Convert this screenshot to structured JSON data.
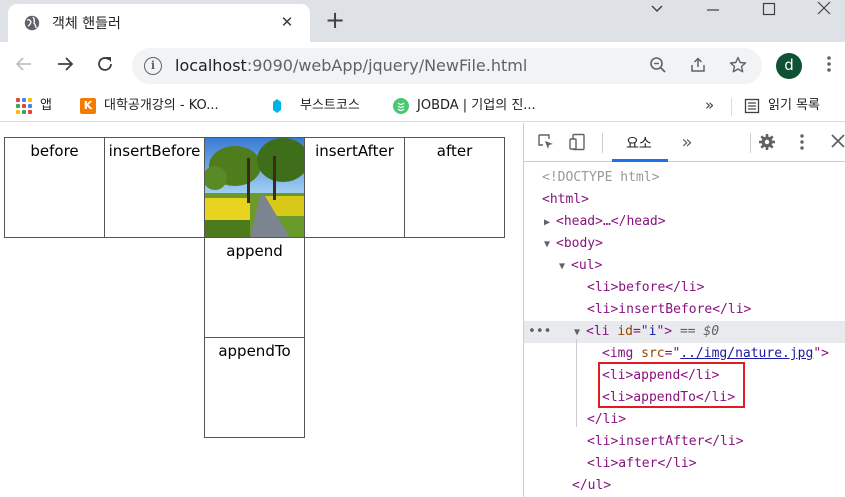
{
  "browser": {
    "tab_title": "객체 핸들러",
    "url_host": "localhost",
    "url_rest": ":9090/webApp/jquery/NewFile.html",
    "avatar_letter": "d"
  },
  "bookmarks": [
    {
      "label": "앱",
      "icon": "apps-grid-icon"
    },
    {
      "label": "대학공개강의 - KO...",
      "icon": "kocw-icon"
    },
    {
      "label": "부스트코스",
      "icon": "boostcourse-icon"
    },
    {
      "label": "JOBDA | 기업의 진...",
      "icon": "jobda-icon"
    }
  ],
  "reading_list": "읽기 목록",
  "page": {
    "before": "before",
    "insertBefore": "insertBefore",
    "insertAfter": "insertAfter",
    "after": "after",
    "append": "append",
    "appendTo": "appendTo"
  },
  "devtools": {
    "elements_tab": "요소",
    "dom": {
      "doctype": "<!DOCTYPE html>",
      "html": "<html>",
      "head": "<head>…</head>",
      "body": "<body>",
      "ul": "<ul>",
      "li_before": "<li>before</li>",
      "li_insertBefore": "<li>insertBefore</li>",
      "li_selected_open": "<li ",
      "li_selected_attr": "id",
      "li_selected_eq": "=\"",
      "li_selected_val": "i",
      "li_selected_close": "\">",
      "li_selected_marker": "== $0",
      "img_open": "<img ",
      "img_attr": "src",
      "img_eq": "=\"",
      "img_src": "../img/nature.jpg",
      "img_close": "\">",
      "li_append": "<li>append</li>",
      "li_appendTo": "<li>appendTo</li>",
      "li_close": "</li>",
      "li_insertAfter": "<li>insertAfter</li>",
      "li_after": "<li>after</li>",
      "ul_close": "</ul>"
    }
  },
  "colors": {
    "highlight_box": "#e01b24",
    "tag": "#881280",
    "attr": "#994500",
    "value": "#1a1aa6"
  }
}
